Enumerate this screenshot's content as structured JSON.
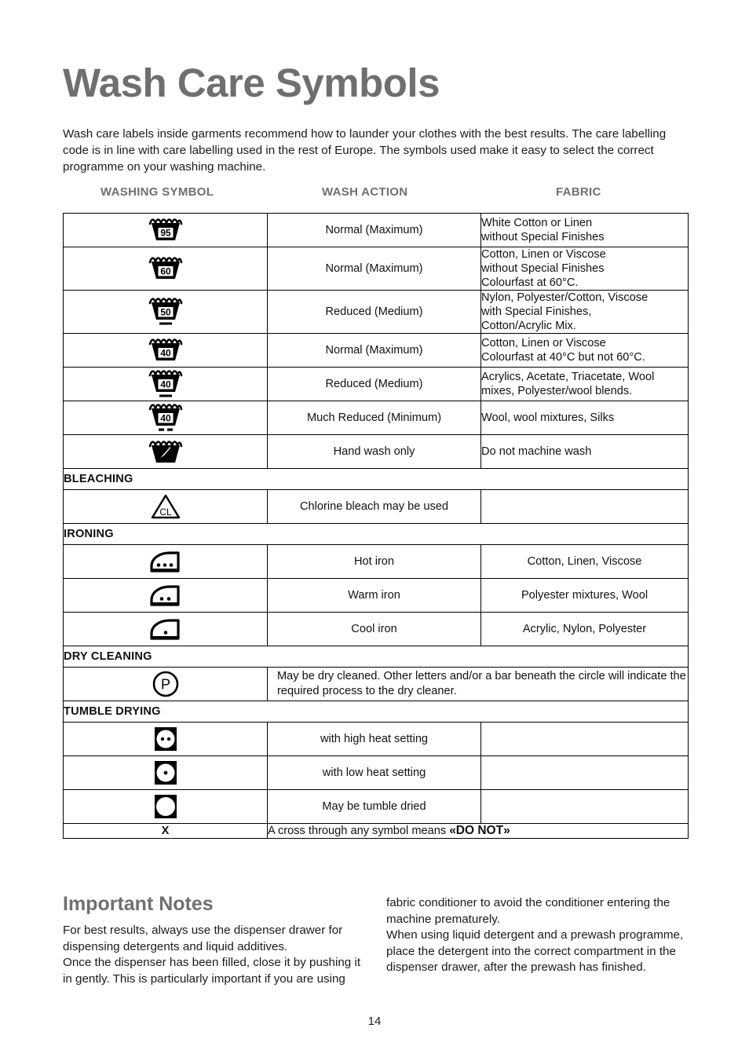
{
  "document": {
    "title": "Wash Care Symbols",
    "intro": "Wash care labels inside garments recommend how to launder your clothes with the best results. The care labelling code is in line with care labelling used in the rest of Europe. The symbols used make it easy to select the correct programme on your washing machine.",
    "page_number": "14",
    "heading_color": "#6f6f6f"
  },
  "table": {
    "headers": {
      "symbol": "WASHING SYMBOL",
      "action": "WASH ACTION",
      "fabric": "FABRIC"
    },
    "rows": [
      {
        "symbol": "wash-tub-95-icon",
        "symbol_value": "95",
        "bars": 0,
        "action": "Normal (Maximum)",
        "fabric": "White Cotton or Linen\nwithout Special Finishes"
      },
      {
        "symbol": "wash-tub-60-icon",
        "symbol_value": "60",
        "bars": 0,
        "action": "Normal (Maximum)",
        "fabric": "Cotton, Linen or Viscose\nwithout Special Finishes\nColourfast at 60°C."
      },
      {
        "symbol": "wash-tub-50-icon",
        "symbol_value": "50",
        "bars": 1,
        "action": "Reduced (Medium)",
        "fabric": "Nylon, Polyester/Cotton, Viscose\nwith Special Finishes,\nCotton/Acrylic Mix."
      },
      {
        "symbol": "wash-tub-40-icon",
        "symbol_value": "40",
        "bars": 0,
        "action": "Normal (Maximum)",
        "fabric": "Cotton, Linen or Viscose\nColourfast at 40°C but not 60°C."
      },
      {
        "symbol": "wash-tub-40-single-bar-icon",
        "symbol_value": "40",
        "bars": 1,
        "action": "Reduced (Medium)",
        "fabric": "Acrylics, Acetate, Triacetate, Wool\nmixes, Polyester/wool blends."
      },
      {
        "symbol": "wash-tub-40-double-bar-icon",
        "symbol_value": "40",
        "bars": 2,
        "action": "Much Reduced (Minimum)",
        "fabric": "Wool, wool mixtures, Silks"
      },
      {
        "symbol": "hand-wash-icon",
        "symbol_value": "",
        "bars": 0,
        "action": "Hand wash only",
        "fabric": "Do not machine wash"
      }
    ],
    "sections": [
      {
        "heading": "BLEACHING",
        "rows": [
          {
            "symbol": "bleach-triangle-cl-icon",
            "symbol_value": "CL",
            "action": "Chlorine bleach may be used",
            "fabric": ""
          }
        ]
      },
      {
        "heading": "IRONING",
        "rows": [
          {
            "symbol": "iron-three-dots-icon",
            "dots": 3,
            "action": "Hot iron",
            "fabric": "Cotton, Linen, Viscose"
          },
          {
            "symbol": "iron-two-dots-icon",
            "dots": 2,
            "action": "Warm iron",
            "fabric": "Polyester mixtures, Wool"
          },
          {
            "symbol": "iron-one-dot-icon",
            "dots": 1,
            "action": "Cool iron",
            "fabric": "Acrylic, Nylon, Polyester"
          }
        ]
      },
      {
        "heading": "DRY CLEANING",
        "rows": [
          {
            "symbol": "dry-clean-circle-p-icon",
            "symbol_value": "P",
            "action": "May be dry cleaned. Other letters and/or a bar beneath the circle will indicate the required process to the dry cleaner."
          }
        ]
      },
      {
        "heading": "TUMBLE DRYING",
        "rows": [
          {
            "symbol": "tumble-dry-two-dots-icon",
            "dots": 2,
            "action": "with high heat setting",
            "fabric": ""
          },
          {
            "symbol": "tumble-dry-one-dot-icon",
            "dots": 1,
            "action": "with low heat setting",
            "fabric": ""
          },
          {
            "symbol": "tumble-dry-icon",
            "dots": 0,
            "action": "May be tumble dried",
            "fabric": ""
          }
        ]
      }
    ],
    "footer_row": {
      "symbol": "cross-x-icon",
      "symbol_value": "X",
      "text_before": "A cross through any symbol means ",
      "text_emphasis": "«DO NOT»"
    }
  },
  "notes": {
    "title": "Important Notes",
    "left_paragraphs": [
      "For best results, always use the dispenser drawer for dispensing detergents and liquid additives.",
      "Once the dispenser has been filled, close it by pushing it in gently. This is particularly important if you are using"
    ],
    "right_paragraphs": [
      "fabric conditioner to avoid the conditioner entering the machine prematurely.",
      "When using liquid detergent and a prewash programme, place the detergent into the correct compartment in the dispenser drawer, after the prewash has finished."
    ]
  }
}
